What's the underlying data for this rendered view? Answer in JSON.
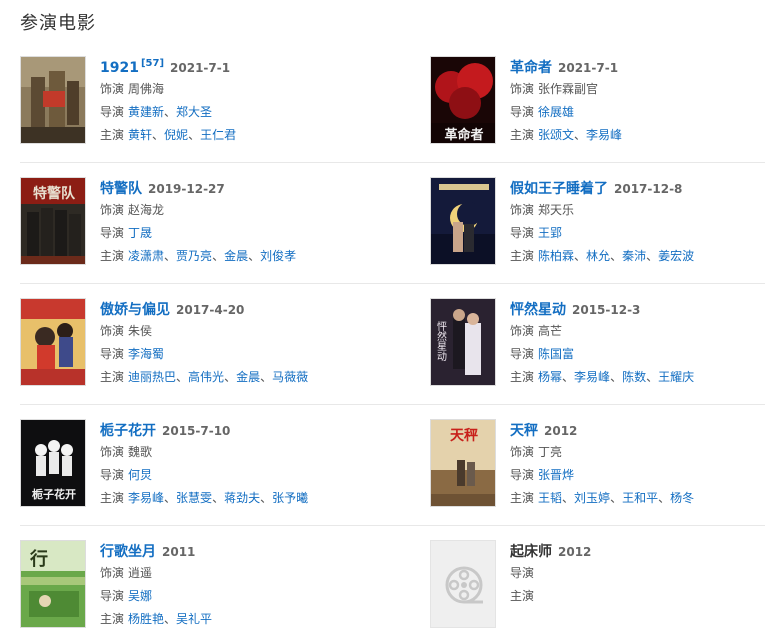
{
  "section_title": "参演电影",
  "labels": {
    "role": "饰演",
    "director": "导演",
    "cast": "主演"
  },
  "separator": "、",
  "films": [
    {
      "title": "1921",
      "ref": "[57]",
      "date": "2021-7-1",
      "role": "周佛海",
      "directors": [
        "黄建新",
        "郑大圣"
      ],
      "cast": [
        "黄轩",
        "倪妮",
        "王仁君"
      ]
    },
    {
      "title": "革命者",
      "ref": "",
      "date": "2021-7-1",
      "role": "张作霖副官",
      "directors": [
        "徐展雄"
      ],
      "cast": [
        "张颂文",
        "李易峰"
      ]
    },
    {
      "title": "特警队",
      "ref": "",
      "date": "2019-12-27",
      "role": "赵海龙",
      "directors": [
        "丁晟"
      ],
      "cast": [
        "凌潇肃",
        "贾乃亮",
        "金晨",
        "刘俊孝"
      ]
    },
    {
      "title": "假如王子睡着了",
      "ref": "",
      "date": "2017-12-8",
      "role": "郑天乐",
      "directors": [
        "王郢"
      ],
      "cast": [
        "陈柏霖",
        "林允",
        "秦沛",
        "姜宏波"
      ]
    },
    {
      "title": "傲娇与偏见",
      "ref": "",
      "date": "2017-4-20",
      "role": "朱侯",
      "directors": [
        "李海蜀"
      ],
      "cast": [
        "迪丽热巴",
        "高伟光",
        "金晨",
        "马薇薇"
      ]
    },
    {
      "title": "怦然星动",
      "ref": "",
      "date": "2015-12-3",
      "role": "高芒",
      "directors": [
        "陈国富"
      ],
      "cast": [
        "杨幂",
        "李易峰",
        "陈数",
        "王耀庆"
      ]
    },
    {
      "title": "栀子花开",
      "ref": "",
      "date": "2015-7-10",
      "role": "魏歌",
      "directors": [
        "何炅"
      ],
      "cast": [
        "李易峰",
        "张慧雯",
        "蒋劲夫",
        "张予曦"
      ]
    },
    {
      "title": "天秤",
      "ref": "",
      "date": "2012",
      "role": "丁亮",
      "directors": [
        "张晋烨"
      ],
      "cast": [
        "王韬",
        "刘玉婷",
        "王和平",
        "杨冬"
      ]
    },
    {
      "title": "行歌坐月",
      "ref": "",
      "date": "2011",
      "role": "逍遥",
      "directors": [
        "吴娜"
      ],
      "cast": [
        "杨胜艳",
        "吴礼平"
      ]
    },
    {
      "title": "起床师",
      "ref": "",
      "date": "2012",
      "role": "",
      "directors": [],
      "cast": [],
      "no_poster": true,
      "no_role_line": true
    }
  ],
  "poster_texts": {
    "p1": "革命者",
    "p3": "特警队",
    "p6": "怦然星动",
    "p7": "栀子花开",
    "p8": "天秤",
    "p9": "行"
  }
}
